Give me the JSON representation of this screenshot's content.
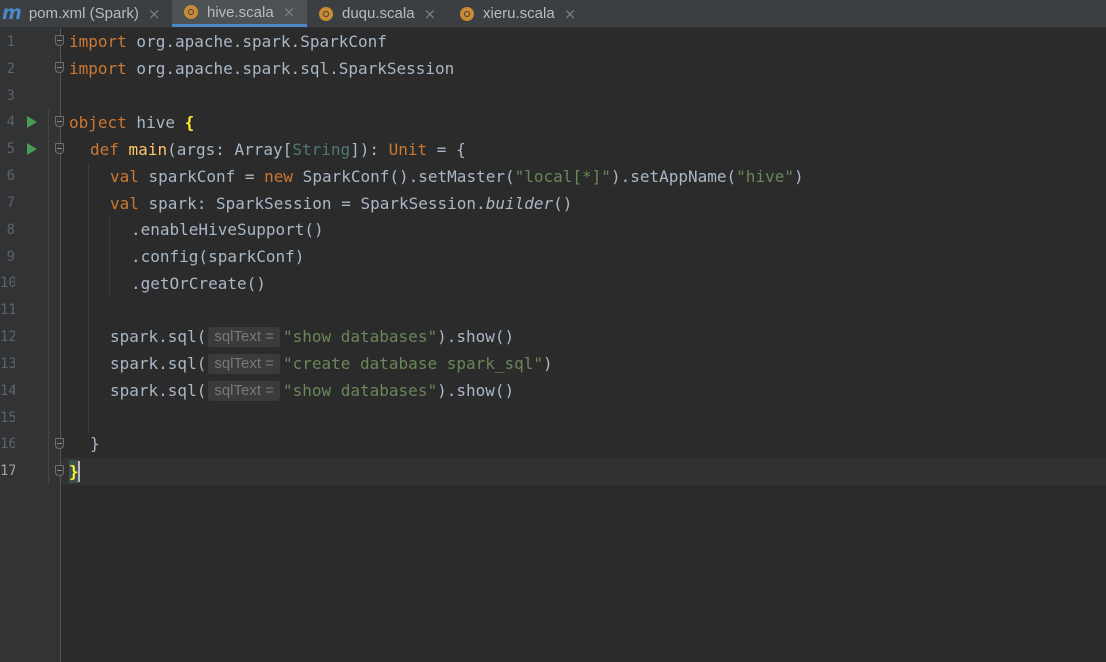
{
  "tabs": [
    {
      "label": "pom.xml (Spark)",
      "icon": "maven-icon",
      "active": false
    },
    {
      "label": "hive.scala",
      "icon": "scala-object-icon",
      "active": true
    },
    {
      "label": "duqu.scala",
      "icon": "scala-object-icon",
      "active": false
    },
    {
      "label": "xieru.scala",
      "icon": "scala-object-icon",
      "active": false
    }
  ],
  "tab_close_glyph": "×",
  "maven_glyph": "m",
  "line_numbers": [
    "1",
    "2",
    "3",
    "4",
    "5",
    "6",
    "7",
    "8",
    "9",
    "10",
    "11",
    "12",
    "13",
    "14",
    "15",
    "16",
    "17"
  ],
  "code": {
    "l1_kw": "import",
    "l1_rest": " org.apache.spark.SparkConf",
    "l2_kw": "import",
    "l2_rest": " org.apache.spark.sql.SparkSession",
    "l4_kw": "object",
    "l4_name": " hive ",
    "l4_brace": "{",
    "l5_kw": "def",
    "l5_fn": "main",
    "l5_a": "(args: Array[",
    "l5_type": "String",
    "l5_b": "]): ",
    "l5_unit": "Unit",
    "l5_c": " = {",
    "l6_kw": "val",
    "l6_a": " sparkConf = ",
    "l6_new": "new",
    "l6_b": " SparkConf().setMaster(",
    "l6_s1": "\"local[*]\"",
    "l6_c": ").setAppName(",
    "l6_s2": "\"hive\"",
    "l6_d": ")",
    "l7_kw": "val",
    "l7_a": " spark: SparkSession = SparkSession.",
    "l7_it": "builder",
    "l7_b": "()",
    "l8": ".enableHiveSupport()",
    "l9": ".config(sparkConf)",
    "l10": ".getOrCreate()",
    "l12_a": "spark.sql(",
    "l12_hint": "sqlText =",
    "l12_s": "\"show databases\"",
    "l12_b": ").show()",
    "l13_a": "spark.sql(",
    "l13_hint": "sqlText =",
    "l13_s": "\"create database spark_sql\"",
    "l13_b": ")",
    "l14_a": "spark.sql(",
    "l14_hint": "sqlText =",
    "l14_s": "\"show databases\"",
    "l14_b": ").show()",
    "l16": "}",
    "l17": "}"
  },
  "colors": {
    "keyword": "#cc7832",
    "string": "#6a8759",
    "function": "#ffc66d",
    "type": "#507874",
    "text": "#a9b7c6",
    "background": "#2b2b2b"
  }
}
